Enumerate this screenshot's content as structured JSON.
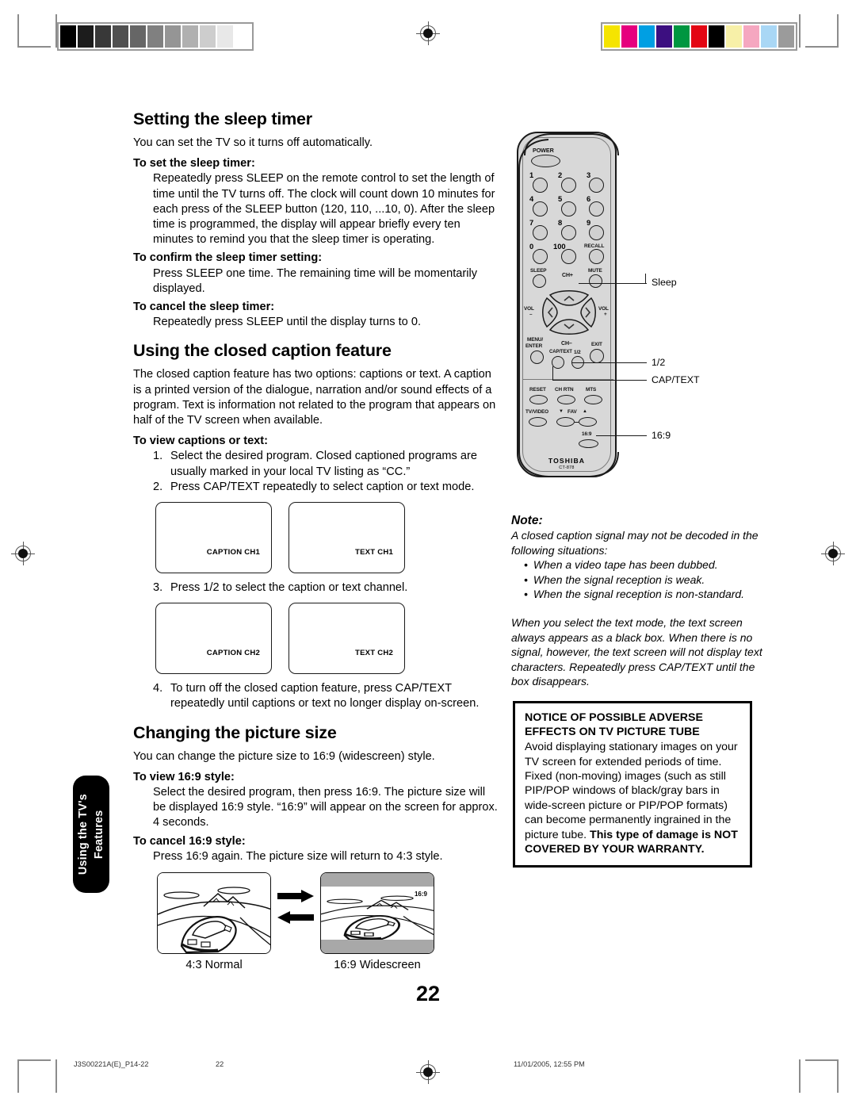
{
  "page": {
    "number": "22",
    "side_tab": "Using the TV's\nFeatures"
  },
  "sections": [
    {
      "title": "Setting the sleep timer",
      "intro": "You can set the TV so it turns off automatically.",
      "blocks": [
        {
          "heading": "To set the sleep timer:",
          "body": "Repeatedly press SLEEP on the remote control to set the length of time until the TV turns off. The clock will count down 10 minutes for each press of the SLEEP button (120, 110, ...10, 0). After the sleep time is programmed, the display will appear briefly every ten minutes to remind you that the sleep timer is operating."
        },
        {
          "heading": "To confirm the sleep timer setting:",
          "body": "Press SLEEP one time. The remaining time will be momentarily displayed."
        },
        {
          "heading": "To cancel the sleep timer:",
          "body": "Repeatedly press SLEEP until the display turns to 0."
        }
      ]
    },
    {
      "title": "Using the closed caption feature",
      "intro": "The closed caption feature has two options: captions or text. A caption is a printed version of the dialogue, narration and/or sound effects of a program. Text is information not related to the program that appears on half of the TV screen when available.",
      "sub_heading": "To view captions or text:",
      "steps": [
        {
          "n": "1.",
          "t": "Select the desired program. Closed captioned programs are usually marked in your local TV listing as “CC.”"
        },
        {
          "n": "2.",
          "t": "Press CAP/TEXT repeatedly to select caption or text mode."
        },
        {
          "n": "3.",
          "t": "Press 1/2 to select the caption or text channel."
        },
        {
          "n": "4.",
          "t": "To turn off the closed caption feature, press CAP/TEXT repeatedly until captions or text no longer display on-screen."
        }
      ],
      "screens_row1": [
        "CAPTION CH1",
        "TEXT CH1"
      ],
      "screens_row2": [
        "CAPTION CH2",
        "TEXT CH2"
      ]
    },
    {
      "title": "Changing the picture size",
      "intro": "You can change the picture size to 16:9 (widescreen) style.",
      "blocks": [
        {
          "heading": "To view 16:9 style:",
          "body": "Select the desired program, then press 16:9. The picture size will be displayed 16:9 style. “16:9” will appear on the screen for approx. 4 seconds."
        },
        {
          "heading": "To cancel 16:9 style:",
          "body": "Press 16:9 again. The picture size will return to 4:3 style."
        }
      ],
      "picture_examples": {
        "normal_caption": "4:3 Normal",
        "wide_caption": "16:9 Widescreen",
        "wide_tag": "16:9"
      }
    }
  ],
  "remote": {
    "power_label": "POWER",
    "keys": [
      "1",
      "2",
      "3",
      "4",
      "5",
      "6",
      "7",
      "8",
      "9",
      "0",
      "100"
    ],
    "recall_label": "RECALL",
    "sleep_label": "SLEEP",
    "mute_label": "MUTE",
    "ch_up_label": "CH+",
    "ch_down_label": "CH–",
    "vol_down_label": "VOL",
    "vol_down_sign": "–",
    "vol_up_label": "VOL",
    "vol_up_sign": "+",
    "menu_label": "MENU/",
    "enter_label": "ENTER",
    "exit_label": "EXIT",
    "captext_label": "CAP/TEXT",
    "half_label": "1/2",
    "reset_label": "RESET",
    "chrtn_label": "CH RTN",
    "mts_label": "MTS",
    "tvvideo_label": "TV/VIDEO",
    "fav_label": "FAV",
    "fav_down": "▼",
    "fav_up": "▲",
    "wide_label": "16:9",
    "brand": "TOSHIBA",
    "model": "CT-878",
    "callouts": [
      {
        "label": "Sleep"
      },
      {
        "label": "1/2"
      },
      {
        "label": "CAP/TEXT"
      },
      {
        "label": "16:9"
      }
    ]
  },
  "note": {
    "title": "Note:",
    "lead": "A closed caption signal may not be decoded in the following situations:",
    "bullets": [
      "When a video tape has been dubbed.",
      "When the signal reception is weak.",
      "When the signal reception is non-standard."
    ],
    "paragraph": "When you select the text mode, the text screen always appears as a black box. When there is no signal, however, the text screen will not display text characters. Repeatedly press CAP/TEXT until the box disappears."
  },
  "warning": {
    "heading_line1": "NOTICE OF POSSIBLE ADVERSE",
    "heading_line2": "EFFECTS ON TV PICTURE TUBE",
    "body_normal": "Avoid displaying stationary images on your TV screen for extended periods of time. Fixed (non-moving) images (such as still PIP/POP windows of black/gray bars in wide-screen picture or PIP/POP formats) can become permanently ingrained in the picture tube. ",
    "body_bold": "This type of damage is NOT COVERED BY YOUR WARRANTY."
  },
  "footer": {
    "file": "J3S00221A(E)_P14-22",
    "page": "22",
    "timestamp": "11/01/2005, 12:55 PM"
  },
  "print_marks": {
    "gray_steps": [
      "#000000",
      "#1c1c1c",
      "#383838",
      "#505050",
      "#666666",
      "#808080",
      "#959595",
      "#b0b0b0",
      "#cdcdcd",
      "#e8e8e8",
      "#ffffff"
    ],
    "color_steps": [
      "#f5e400",
      "#e6007e",
      "#009fe3",
      "#3c0f80",
      "#009640",
      "#e30613",
      "#000000",
      "#f7f0a8",
      "#f5a7c0",
      "#a9d7f5",
      "#9b9b9b"
    ]
  }
}
